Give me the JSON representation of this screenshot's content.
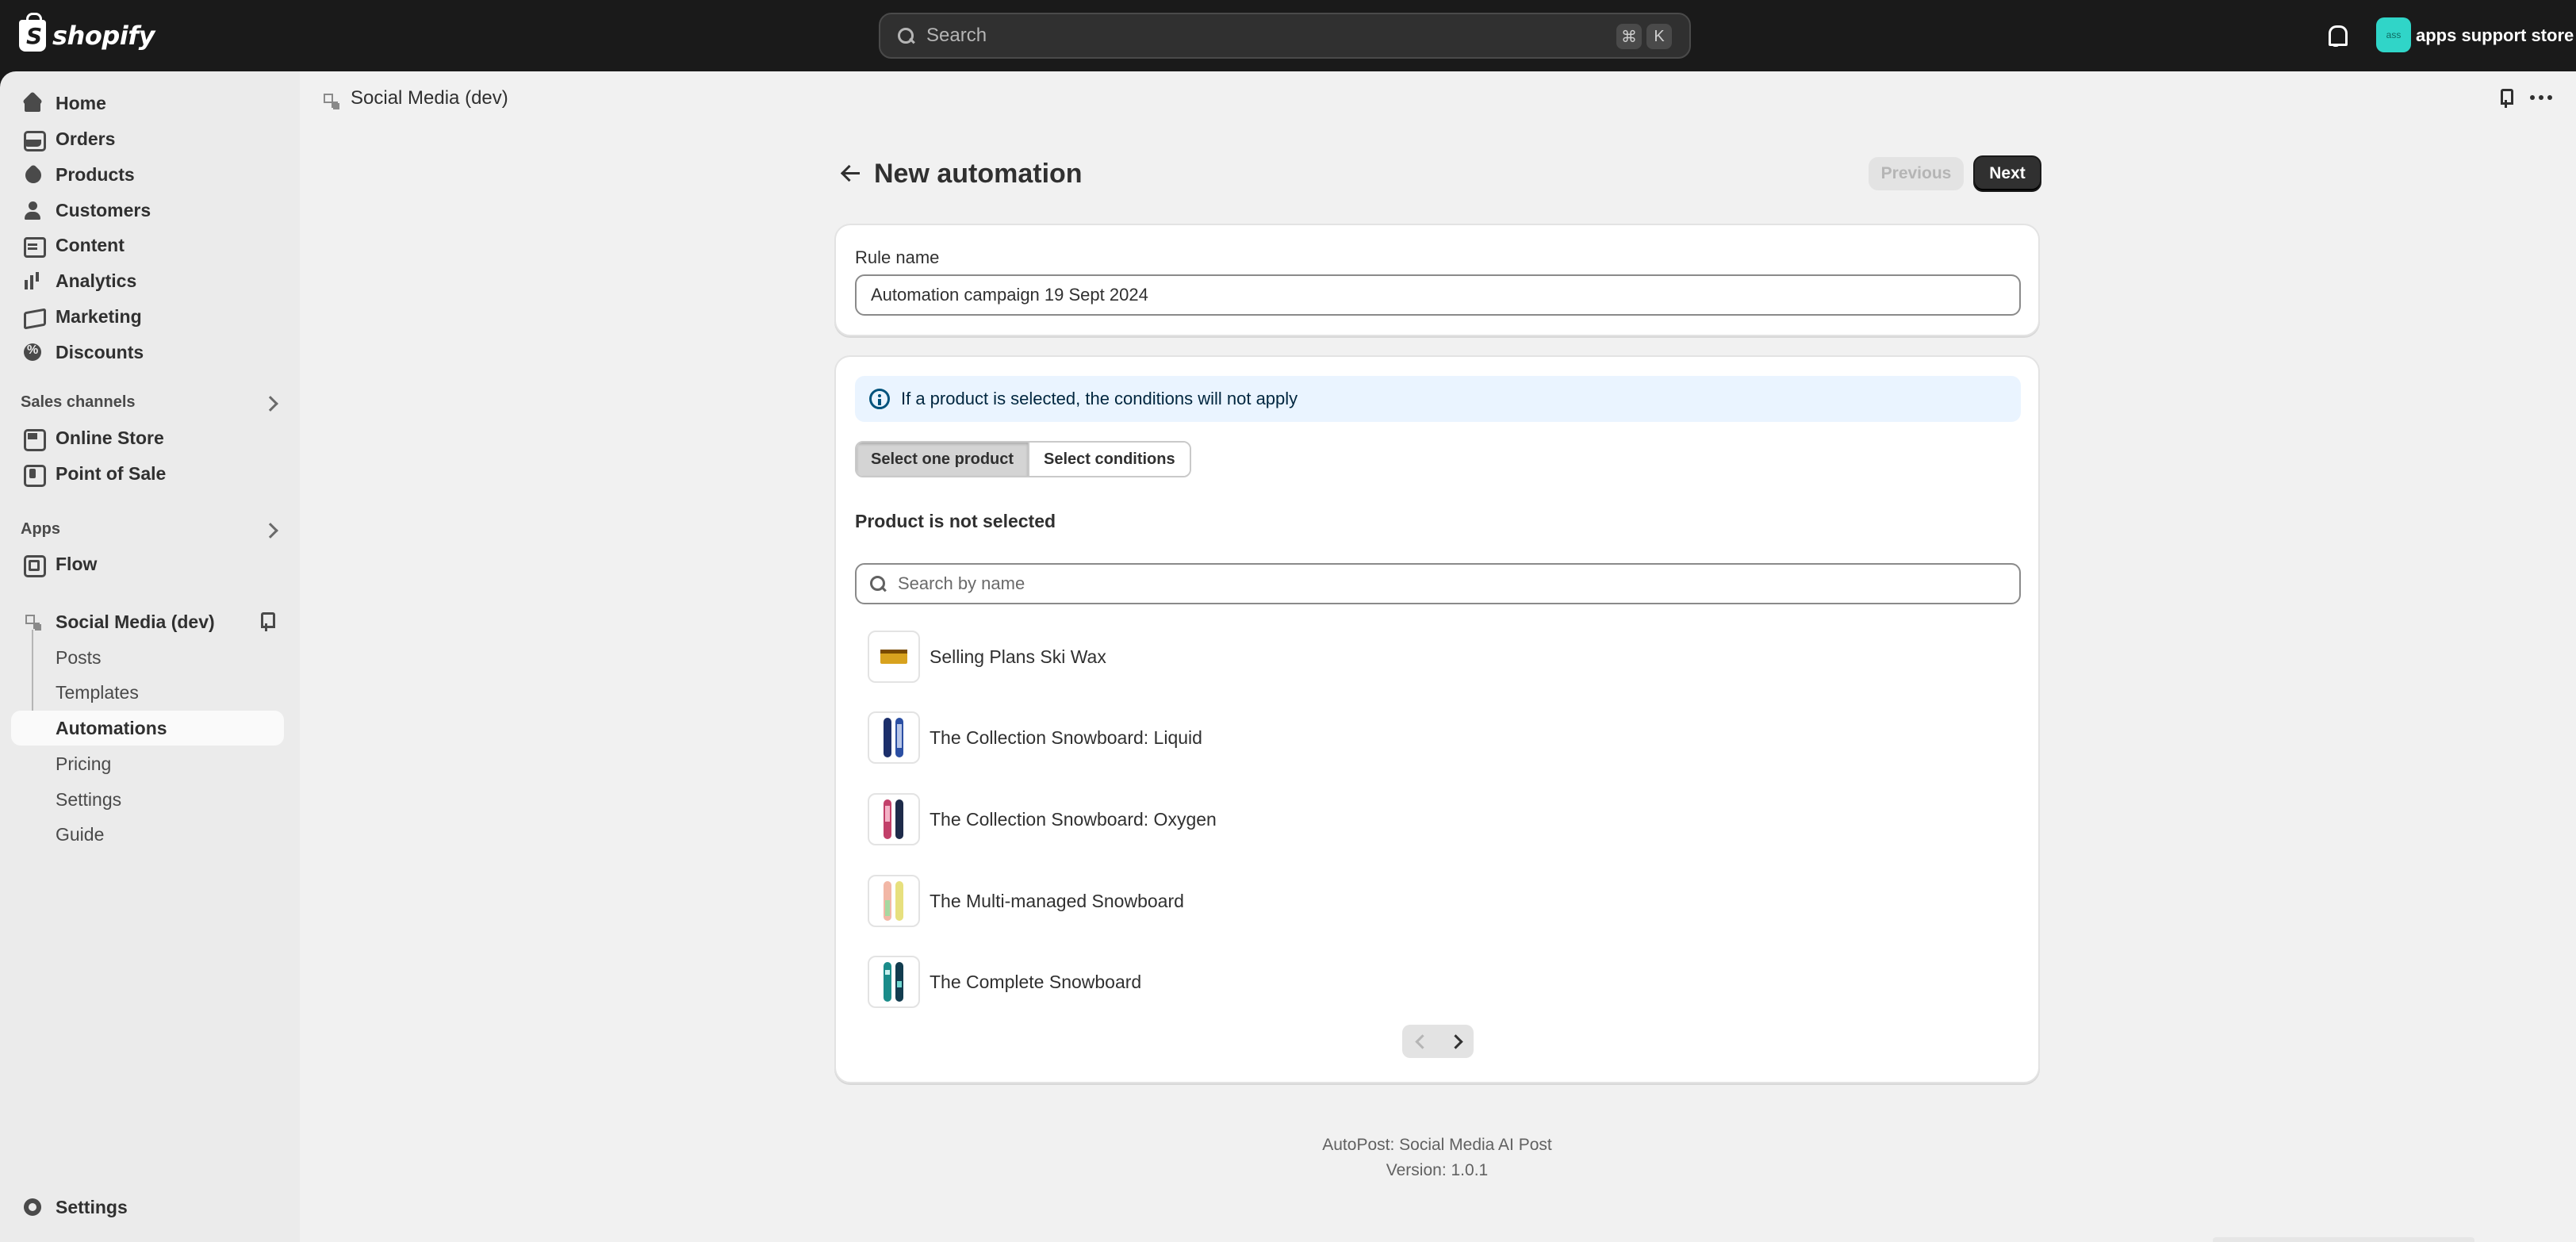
{
  "topbar": {
    "logo_text": "shopify",
    "search_placeholder": "Search",
    "shortcut_keys": [
      "⌘",
      "K"
    ],
    "store_avatar_initials": "ass",
    "store_name": "apps support store"
  },
  "sidebar": {
    "main_items": [
      {
        "label": "Home",
        "icon": "home-icon"
      },
      {
        "label": "Orders",
        "icon": "inbox-icon"
      },
      {
        "label": "Products",
        "icon": "tag-icon"
      },
      {
        "label": "Customers",
        "icon": "person-icon"
      },
      {
        "label": "Content",
        "icon": "document-icon"
      },
      {
        "label": "Analytics",
        "icon": "bar-chart-icon"
      },
      {
        "label": "Marketing",
        "icon": "megaphone-icon"
      },
      {
        "label": "Discounts",
        "icon": "discount-icon"
      }
    ],
    "sales_channels_title": "Sales channels",
    "sales_channels": [
      {
        "label": "Online Store",
        "icon": "store-icon"
      },
      {
        "label": "Point of Sale",
        "icon": "pos-icon"
      }
    ],
    "apps_title": "Apps",
    "apps": [
      {
        "label": "Flow",
        "icon": "flow-icon"
      }
    ],
    "active_app": {
      "label": "Social Media (dev)",
      "sub_items": [
        "Posts",
        "Templates",
        "Automations",
        "Pricing",
        "Settings",
        "Guide"
      ],
      "selected": "Automations"
    },
    "settings_label": "Settings"
  },
  "app_header": {
    "title": "Social Media (dev)"
  },
  "page": {
    "title": "New automation",
    "previous_label": "Previous",
    "next_label": "Next"
  },
  "rule_card": {
    "label": "Rule name",
    "value": "Automation campaign 19 Sept 2024"
  },
  "product_card": {
    "banner_text": "If a product is selected, the conditions will not apply",
    "segments": [
      "Select one product",
      "Select conditions"
    ],
    "selected_segment": "Select one product",
    "status_heading": "Product is not selected",
    "search_placeholder": "Search by name",
    "products": [
      "Selling Plans Ski Wax",
      "The Collection Snowboard: Liquid",
      "The Collection Snowboard: Oxygen",
      "The Multi-managed Snowboard",
      "The Complete Snowboard"
    ]
  },
  "footer": {
    "app_name": "AutoPost: Social Media AI Post",
    "version": "Version: 1.0.1"
  },
  "colors": {
    "topbar_bg": "#1a1a1a",
    "sidebar_bg": "#ebebeb",
    "main_bg": "#f1f1f1",
    "primary_button": "#303030",
    "info_banner_bg": "#eaf4ff",
    "avatar_bg": "#30d5c8"
  }
}
